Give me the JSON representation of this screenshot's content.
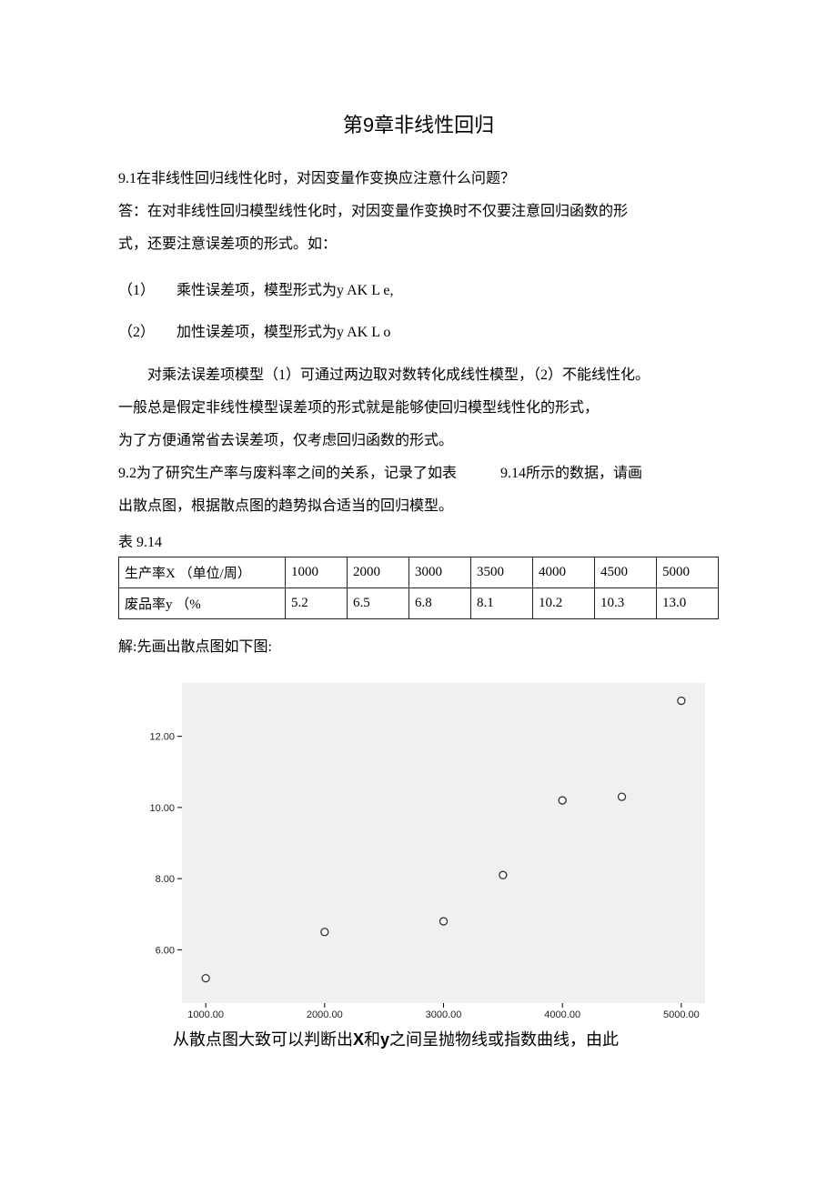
{
  "title": "第9章非线性回归",
  "q1_prompt": "9.1在非线性回归线性化时，对因变量作变换应注意什么问题？",
  "q1_answer_l1": "答：在对非线性回归模型线性化时，对因变量作变换时不仅要注意回归函数的形",
  "q1_answer_l2": "式，还要注意误差项的形式。如：",
  "item1_num": "（1）",
  "item1_text": "乘性误差项，模型形式为y AK L e,",
  "item2_num": "（2）",
  "item2_text": "加性误差项，模型形式为y AK L o",
  "discussion_l1": "对乘法误差项模型（1）可通过两边取对数转化成线性模型，（2）不能线性化。",
  "discussion_l2": "一般总是假定非线性模型误差项的形式就是能够使回归模型线性化的形式，",
  "discussion_l3": "为了方便通常省去误差项，仅考虑回归函数的形式。",
  "q2_l1a": "9.2为了研究生产率与废料率之间的关系，记录了如表",
  "q2_l1b": "9.14所示的数据，请画",
  "q2_l2": "出散点图，根据散点图的趋势拟合适当的回归模型。",
  "table_label": "表 9.14",
  "table": {
    "row1_head": "生产率X （单位/周）",
    "row1": [
      "1000",
      "2000",
      "3000",
      "3500",
      "4000",
      "4500",
      "5000"
    ],
    "row2_head": "废品率y （%",
    "row2": [
      "5.2",
      "6.5",
      "6.8",
      "8.1",
      "10.2",
      "10.3",
      "13.0"
    ]
  },
  "ans_intro": "解:先画出散点图如下图:",
  "chart_data": {
    "type": "scatter",
    "x": [
      1000,
      2000,
      3000,
      3500,
      4000,
      4500,
      5000
    ],
    "y": [
      5.2,
      6.5,
      6.8,
      8.1,
      10.2,
      10.3,
      13.0
    ],
    "xlim": [
      800,
      5200
    ],
    "ylim": [
      4.5,
      13.5
    ],
    "x_ticks": [
      1000.0,
      2000.0,
      3000.0,
      4000.0,
      5000.0
    ],
    "y_ticks": [
      6.0,
      8.0,
      10.0,
      12.0
    ],
    "title": "",
    "xlabel": "",
    "ylabel": ""
  },
  "conclusion_pre": "从散点图大致可以判断出",
  "conclusion_x": "X",
  "conclusion_mid": "和",
  "conclusion_y": "y",
  "conclusion_post": "之间呈抛物线或指数曲线，由此"
}
